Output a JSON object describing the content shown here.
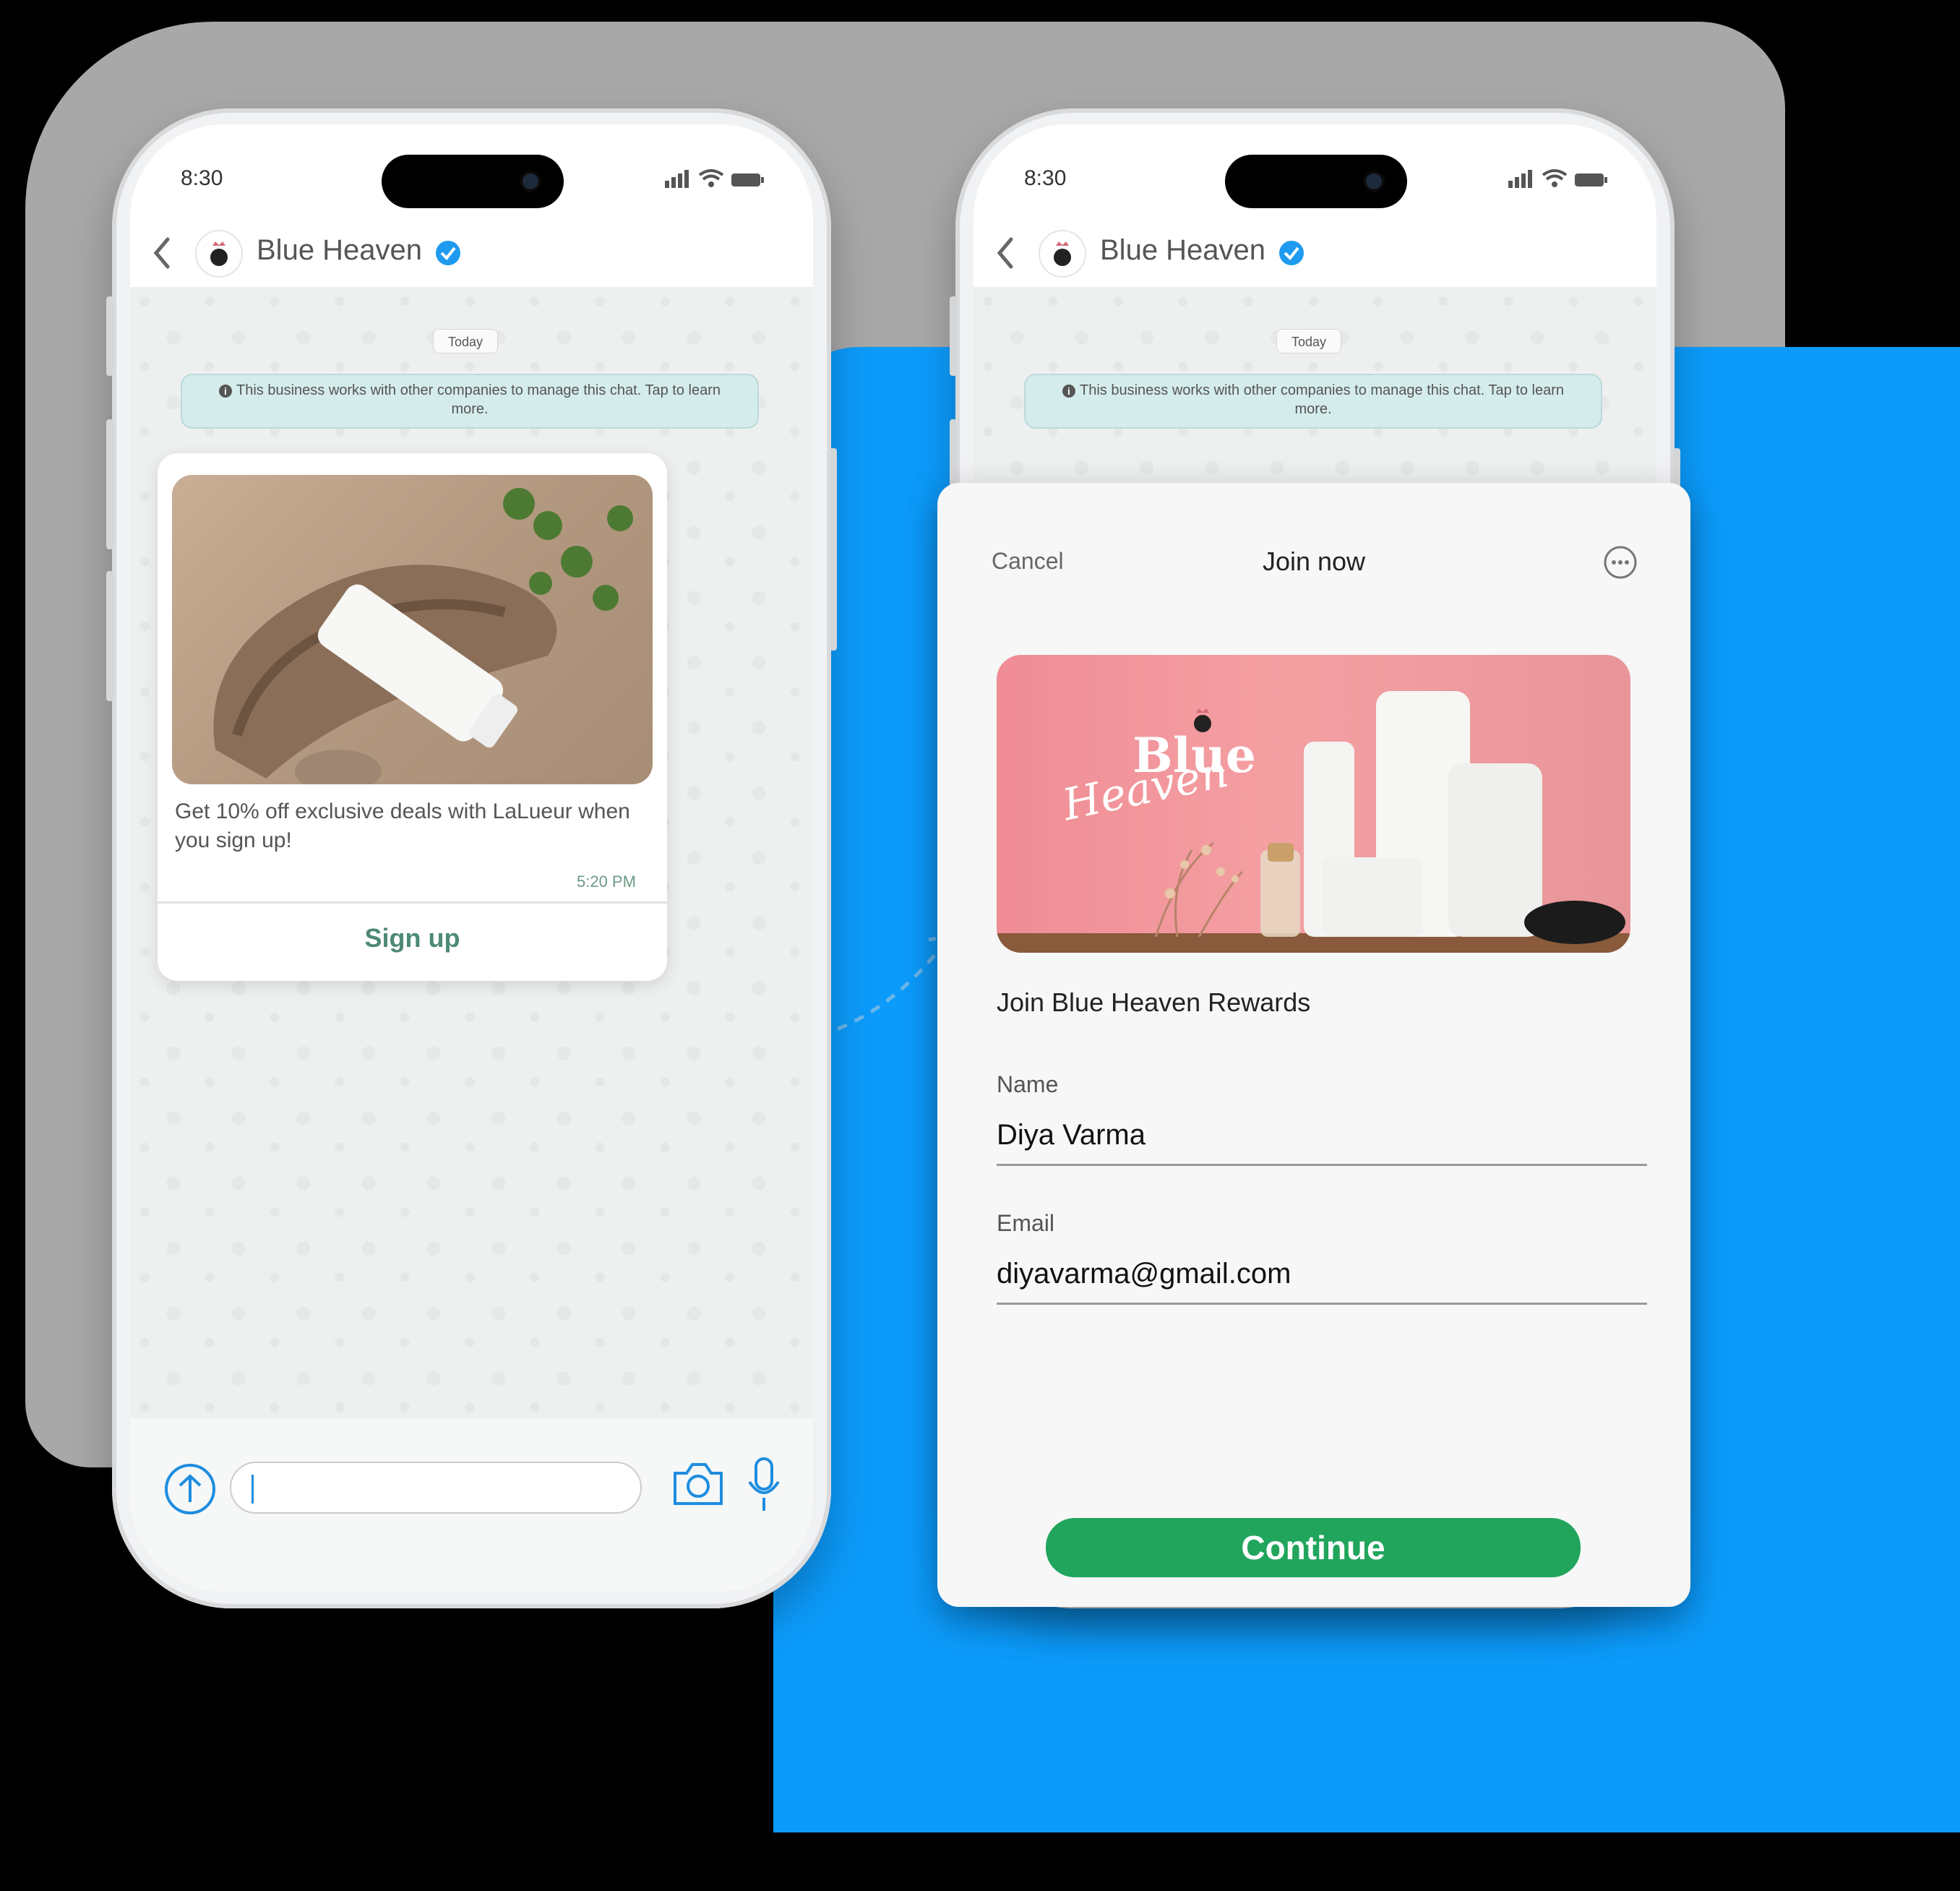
{
  "left_phone": {
    "status_time": "8:30",
    "contact_name": "Blue Heaven",
    "date_pill": "Today",
    "info_text": "This business works with other companies to manage this chat. Tap to learn more.",
    "message": {
      "image_alt": "Blue Heaven tube on driftwood",
      "text": "Get 10% off exclusive deals with LaLueur when you sign up!",
      "time": "5:20 PM",
      "cta": "Sign up"
    },
    "logo_text": "Blue Heaven"
  },
  "right_phone": {
    "status_time": "8:30",
    "contact_name": "Blue Heaven",
    "date_pill": "Today",
    "info_text": "This business works with other companies to manage this chat. Tap to learn more.",
    "sheet": {
      "cancel": "Cancel",
      "title": "Join now",
      "promo_logo_top": "Blue",
      "promo_logo_bottom": "Heaven",
      "heading": "Join Blue Heaven Rewards",
      "fields": [
        {
          "label": "Name",
          "value": "Diya Varma"
        },
        {
          "label": "Email",
          "value": "diyavarma@gmail.com"
        }
      ],
      "continue": "Continue"
    }
  },
  "colors": {
    "accent_blue": "#0c9bfb",
    "verified_blue": "#1e9bf0",
    "whatsapp_green": "#21a55d",
    "cta_green": "#4e8a75"
  },
  "icons": [
    "back-chevron-icon",
    "verified-badge-icon",
    "signal-icon",
    "wifi-icon",
    "battery-icon",
    "info-icon",
    "upload-icon",
    "camera-icon",
    "mic-icon",
    "more-options-icon"
  ]
}
